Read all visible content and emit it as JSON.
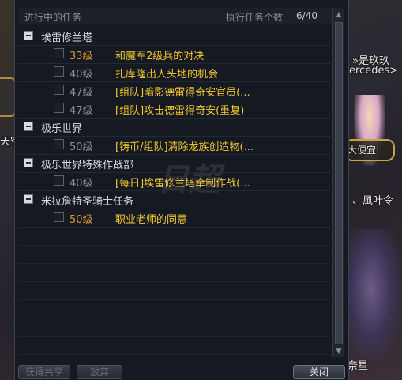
{
  "world": {
    "name_partial": "»是玖玖",
    "guild_partial": "ercedes>",
    "left_partial": "天空",
    "bubble_text": "大便宜!",
    "player_name_partial": "、風叶令",
    "bottom_partial": "奈星"
  },
  "window": {
    "title": "进行中的任务",
    "count_label": "执行任务个数",
    "count_value": "6/40",
    "watermark": "日超"
  },
  "groups": [
    {
      "label": "埃雷修兰塔",
      "quests": [
        {
          "level": "33级",
          "name": "和魔军2级兵的对决",
          "level_color": "orange"
        },
        {
          "level": "40级",
          "name": "扎库隆出人头地的机会",
          "level_color": "gray"
        },
        {
          "level": "47级",
          "name": "[组队]暗影德雷得奇安官员(...",
          "level_color": "gray"
        },
        {
          "level": "47级",
          "name": "[组队]攻击德雷得奇安(重复)",
          "level_color": "gray"
        }
      ]
    },
    {
      "label": "极乐世界",
      "quests": [
        {
          "level": "50级",
          "name": "[铸币/组队]清除龙族创造物(...",
          "level_color": "gray"
        }
      ]
    },
    {
      "label": "极乐世界特殊作战部",
      "quests": [
        {
          "level": "40级",
          "name": "[每日]埃雷修兰塔牵制作战(...",
          "level_color": "gray"
        }
      ]
    },
    {
      "label": "米拉詹特圣骑士任务",
      "quests": [
        {
          "level": "50级",
          "name": "职业老师的同意",
          "level_color": "orange"
        }
      ]
    }
  ],
  "footer": {
    "share_label": "获得共享",
    "abandon_label": "放弃",
    "close_label": "关闭"
  },
  "colors": {
    "quest_name": "#f0c533",
    "level_orange": "#d99a2e",
    "level_gray": "#8b8e92"
  }
}
